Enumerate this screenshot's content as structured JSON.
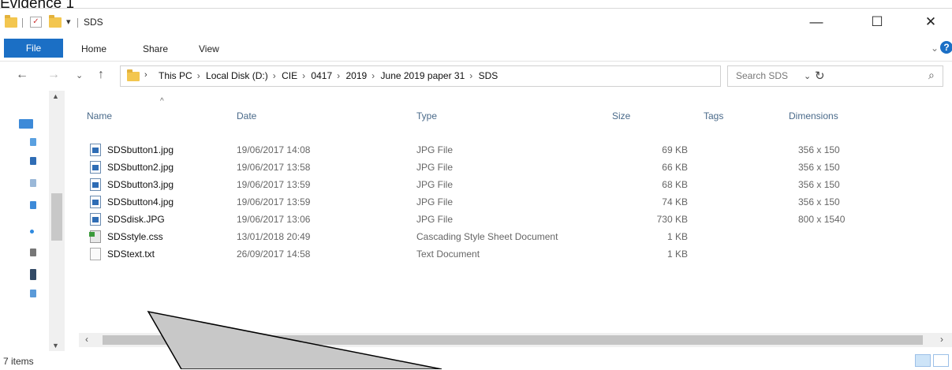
{
  "caption": "Evidence 1",
  "titlebar": {
    "title": "SDS",
    "quick_access_arrow": "▾",
    "minimize": "—",
    "maximize": "☐",
    "close": "✕"
  },
  "ribbon": {
    "tabs": [
      "File",
      "Home",
      "Share",
      "View"
    ],
    "help": "?",
    "chevron": "⌄"
  },
  "address": {
    "back": "←",
    "forward": "→",
    "recent": "⌄",
    "up": "↑",
    "crumbs": [
      "This PC",
      "Local Disk (D:)",
      "CIE",
      "0417",
      "2019",
      "June 2019 paper 31",
      "SDS"
    ],
    "crumb_separator": "›",
    "dropdown": "⌄",
    "refresh": "↻"
  },
  "search": {
    "placeholder": "Search SDS",
    "icon": "⌕"
  },
  "columns": {
    "name": "Name",
    "date": "Date",
    "type": "Type",
    "size": "Size",
    "tags": "Tags",
    "dimensions": "Dimensions"
  },
  "files": [
    {
      "name": "SDSbutton1.jpg",
      "date": "19/06/2017 14:08",
      "type": "JPG File",
      "size": "69 KB",
      "dimensions": "356 x 150",
      "icon": "jpg"
    },
    {
      "name": "SDSbutton2.jpg",
      "date": "19/06/2017 13:58",
      "type": "JPG File",
      "size": "66 KB",
      "dimensions": "356 x 150",
      "icon": "jpg"
    },
    {
      "name": "SDSbutton3.jpg",
      "date": "19/06/2017 13:59",
      "type": "JPG File",
      "size": "68 KB",
      "dimensions": "356 x 150",
      "icon": "jpg"
    },
    {
      "name": "SDSbutton4.jpg",
      "date": "19/06/2017 13:59",
      "type": "JPG File",
      "size": "74 KB",
      "dimensions": "356 x 150",
      "icon": "jpg"
    },
    {
      "name": "SDSdisk.JPG",
      "date": "19/06/2017 13:06",
      "type": "JPG File",
      "size": "730 KB",
      "dimensions": "800 x 1540",
      "icon": "jpg"
    },
    {
      "name": "SDSstyle.css",
      "date": "13/01/2018 20:49",
      "type": "Cascading Style Sheet Document",
      "size": "1 KB",
      "dimensions": "",
      "icon": "css"
    },
    {
      "name": "SDStext.txt",
      "date": "26/09/2017 14:58",
      "type": "Text Document",
      "size": "1 KB",
      "dimensions": "",
      "icon": "txt"
    }
  ],
  "status": {
    "item_count": "7 items"
  },
  "colors": {
    "accent": "#1b6fc5",
    "folder": "#f3c64f",
    "callout": "#c8c8c8"
  }
}
